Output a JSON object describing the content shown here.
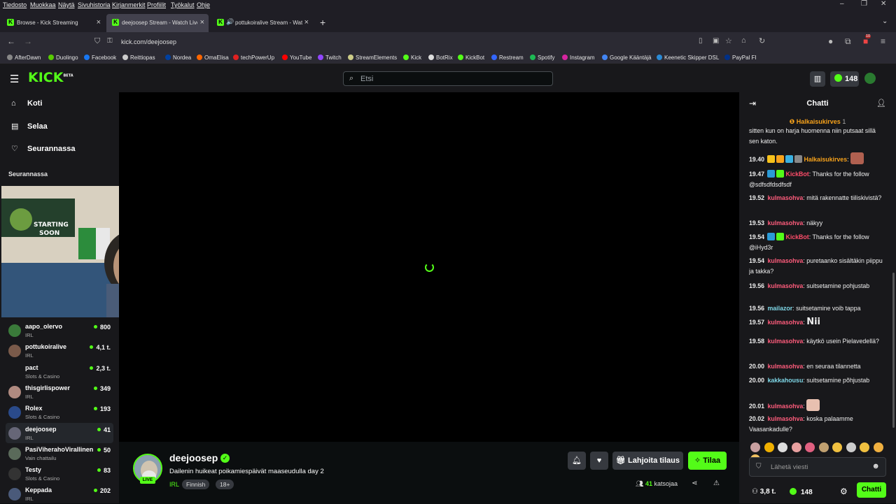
{
  "browser": {
    "menu": [
      "Tiedosto",
      "Muokkaa",
      "Näytä",
      "Sivuhistoria",
      "Kirjanmerkit",
      "Profiilit",
      "Työkalut",
      "Ohje"
    ],
    "tabs": [
      {
        "label": "Browse - Kick Streaming"
      },
      {
        "label": "deejoosep Stream - Watch Live"
      },
      {
        "label": "pottukoiralive Stream - Watch"
      }
    ],
    "url": "kick.com/deejoosep",
    "bookmarks": [
      "AfterDawn",
      "Duolingo",
      "Facebook",
      "Reittiopas",
      "Nordea",
      "OmaElisa",
      "techPowerUp",
      "YouTube",
      "Twitch",
      "StreamElements",
      "Kick",
      "BotRix",
      "KickBot",
      "Restream",
      "Spotify",
      "Instagram",
      "Google Kääntäjä",
      "Keenetic Skipper DSL",
      "PayPal FI"
    ],
    "bookmark_colors": [
      "#888",
      "#58cc02",
      "#1877f2",
      "#ccc",
      "#0040a0",
      "#ff6600",
      "#e02020",
      "#ff0000",
      "#9146ff",
      "#cc8",
      "#53fc18",
      "#ddd",
      "#53fc18",
      "#3366ff",
      "#1db954",
      "#d6249f",
      "#4285f4",
      "#2a8bd6",
      "#003087"
    ],
    "extension_badge": "10"
  },
  "kick": {
    "logo": "KICK",
    "logo_sup": "BETA",
    "search_placeholder": "Etsi",
    "header_points": "148"
  },
  "sidebar": {
    "nav": [
      {
        "label": "Koti",
        "icon": "home-icon",
        "glyph": "⌂"
      },
      {
        "label": "Selaa",
        "icon": "browse-icon",
        "glyph": "▤"
      },
      {
        "label": "Seurannassa",
        "icon": "heart-icon",
        "glyph": "♡"
      }
    ],
    "heading": "Seurannassa",
    "channels": [
      {
        "name": "aapo_olervo",
        "category": "IRL",
        "viewers": "800",
        "color": "#3a7a3a"
      },
      {
        "name": "pottukoiralive",
        "category": "IRL",
        "viewers": "4,1 t.",
        "color": "#7a5a4a"
      },
      {
        "name": "pact",
        "category": "Slots & Casino",
        "viewers": "2,3 t.",
        "color": "#18181b"
      },
      {
        "name": "thisgirlispower",
        "category": "IRL",
        "viewers": "349",
        "color": "#b08a80"
      },
      {
        "name": "Rolex",
        "category": "Slots & Casino",
        "viewers": "193",
        "color": "#2a4a8a"
      },
      {
        "name": "deejoosep",
        "category": "IRL",
        "viewers": "41",
        "color": "#667"
      },
      {
        "name": "PasiViherahoVirallinen",
        "category": "Vain chattailu",
        "viewers": "50",
        "color": "#5a6a5a"
      },
      {
        "name": "Testy",
        "category": "Slots & Casino",
        "viewers": "83",
        "color": "#333"
      },
      {
        "name": "Keppada",
        "category": "IRL",
        "viewers": "202",
        "color": "#4a5a7a"
      }
    ]
  },
  "stream": {
    "name": "deejoosep",
    "live": "LIVE",
    "title": "Dailenin huikeat poikamiespäivät maaseudulla day 2",
    "category": "IRL",
    "tags": [
      "Finnish",
      "18+"
    ],
    "gift_label": "Lahjoita tilaus",
    "subscribe_label": "Tilaa",
    "viewers": "41",
    "viewers_label": "katsojaa"
  },
  "chat": {
    "title": "Chatti",
    "pinned_user": "Halkaisukirves",
    "pinned_count": "1",
    "partial_top": "sitten kun on harja huomenna niin putsaat sillä sen katon.",
    "messages": [
      {
        "time": "19.40",
        "user": "Halkaisukirves",
        "color": "#f7a21b",
        "text": "",
        "badges": [
          "#f7c21b",
          "#f7a21b",
          "#3ab0e0",
          "#888"
        ],
        "emote": "#b06050"
      },
      {
        "time": "19.47",
        "user": "KickBot",
        "color": "#ff4d6a",
        "text": "Thanks for the follow @sdfsdfdsdfsdf",
        "badges": [
          "#2a9ad6",
          "#53fc18"
        ]
      },
      {
        "time": "19.52",
        "user": "kulmasohva",
        "color": "#ff5c7c",
        "text": "mitä rakennatte tiiliskivistä?"
      },
      {
        "time": "19.53",
        "user": "kulmasohva",
        "color": "#ff5c7c",
        "text": "näkyy"
      },
      {
        "time": "19.54",
        "user": "KickBot",
        "color": "#ff4d6a",
        "text": "Thanks for the follow @iHyd3r",
        "badges": [
          "#2a9ad6",
          "#53fc18"
        ]
      },
      {
        "time": "19.54",
        "user": "kulmasohva",
        "color": "#ff5c7c",
        "text": "puretaanko sisältäkin piippu ja takka?"
      },
      {
        "time": "19.56",
        "user": "kulmasohva",
        "color": "#ff5c7c",
        "text": "suitsetamine pohjustab"
      },
      {
        "time": "19.56",
        "user": "mailazor",
        "color": "#7fd8e8",
        "text": "suitsetamine voib tappa"
      },
      {
        "time": "19.57",
        "user": "kulmasohva",
        "color": "#ff5c7c",
        "text": "",
        "emote_text": "Nii"
      },
      {
        "time": "19.58",
        "user": "kulmasohva",
        "color": "#ff5c7c",
        "text": "käytkö usein Pielavedellä?"
      },
      {
        "time": "20.00",
        "user": "kulmasohva",
        "color": "#ff5c7c",
        "text": "en seuraa tilannetta"
      },
      {
        "time": "20.00",
        "user": "kakkahousu",
        "color": "#7fd8e8",
        "text": "suitsetamine põhjustab"
      },
      {
        "time": "20.01",
        "user": "kulmasohva",
        "color": "#ff5c7c",
        "text": "",
        "emote": "#e8c0b0"
      },
      {
        "time": "20.02",
        "user": "kulmasohva",
        "color": "#ff5c7c",
        "text": "koska palaamme Vaasankadulle?"
      }
    ],
    "emote_bar": [
      "#c9a0a0",
      "#f0b000",
      "#ddd",
      "#e8a0a0",
      "#e06080",
      "#c0a070",
      "#f0c040",
      "#ccc",
      "#f0c040",
      "#f0b040",
      "#f0c060"
    ],
    "input_placeholder": "Lähetä viesti",
    "followers": "3,8 t.",
    "points": "148",
    "chat_button": "Chatti"
  }
}
